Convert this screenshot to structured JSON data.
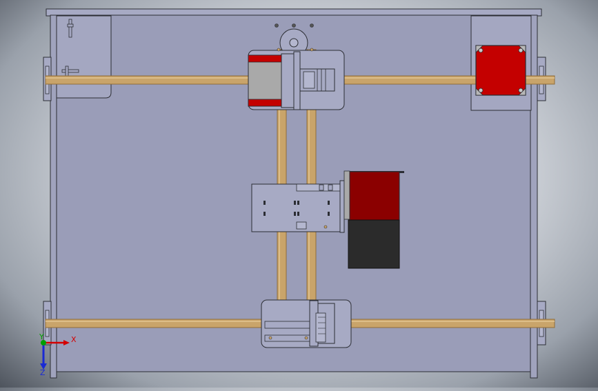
{
  "viewport": {
    "background_center": "#f2f3f5",
    "background_edge": "#4e545d"
  },
  "colors": {
    "base_plate": "#9a9db8",
    "part_fill": "#a7aac4",
    "outline": "#2b2d33",
    "rod": "#c9a46a",
    "rod_shadow": "#8f6d3a",
    "stepper_red": "#8b0000",
    "stepper_bright_red": "#c40000",
    "stepper_black": "#2b2b2b",
    "bracket_gray": "#a9a9a9"
  },
  "triad": {
    "x_label": "X",
    "y_label": "Y",
    "z_label": "Z",
    "x_color": "#d40000",
    "y_color": "#00a000",
    "z_color": "#1a2ad4"
  }
}
